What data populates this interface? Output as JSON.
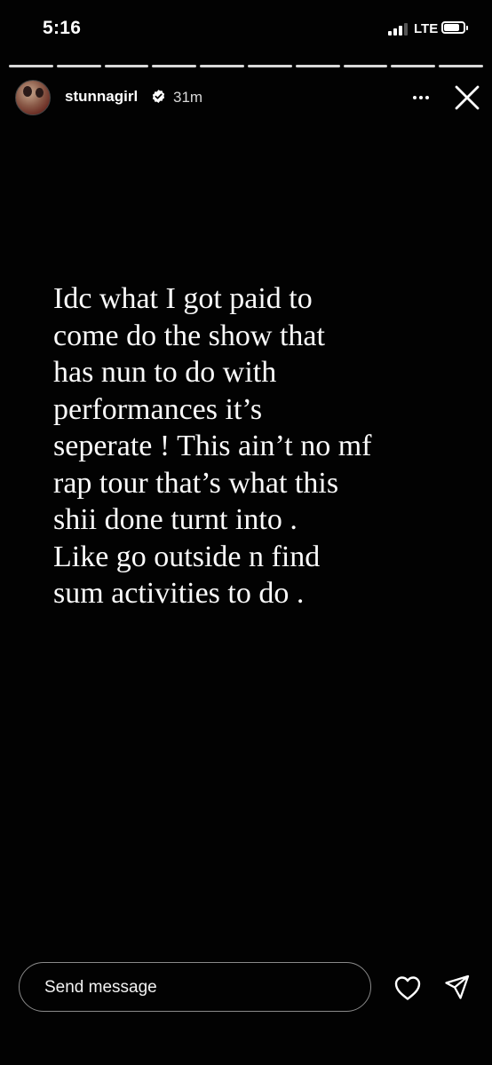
{
  "status_bar": {
    "time": "5:16",
    "network": "LTE",
    "signal_icon": "cellular-signal-icon",
    "battery_icon": "battery-icon",
    "battery_level": 0.82
  },
  "story": {
    "segments_total": 10,
    "segments_viewed": 10,
    "username": "stunnagirl",
    "verified_icon": "verified-badge-icon",
    "time_ago": "31m",
    "more_icon": "more-options-icon",
    "close_icon": "close-icon",
    "text_lines": [
      "Idc what I got paid to",
      "come do the show that",
      "has nun to do with",
      "performances it’s",
      "seperate ! This ain’t no mf",
      "rap tour that’s what this",
      "shii done turnt into .",
      "Like go outside n find",
      "sum activities to do ."
    ]
  },
  "footer": {
    "reply_placeholder": "Send message",
    "like_icon": "heart-icon",
    "share_icon": "send-icon"
  },
  "colors": {
    "background": "#020202",
    "text": "#ffffff",
    "border": "#8a8a8a"
  }
}
